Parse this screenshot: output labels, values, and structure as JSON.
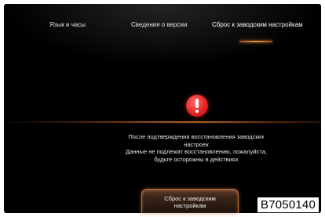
{
  "tabs": [
    {
      "label": "Язык и часы"
    },
    {
      "label": "Сведения о версии"
    },
    {
      "label": "Сброс к заводским настройкам",
      "active": true
    }
  ],
  "warning": {
    "icon": "exclamation-circle-icon",
    "color": "#e32525"
  },
  "message": {
    "line1": "После подтверждения восстановления заводских",
    "line2": "настроек",
    "line3": "Данные не подлежат восстановлению, пожалуйста,",
    "line4": "будьте осторожны в действиях"
  },
  "reset_button": {
    "line1": "Сброс к заводским",
    "line2": "настройкам"
  },
  "image_code": "B7050140",
  "colors": {
    "accent": "#f09a40",
    "background": "#000000",
    "text": "#e8e8e8"
  }
}
